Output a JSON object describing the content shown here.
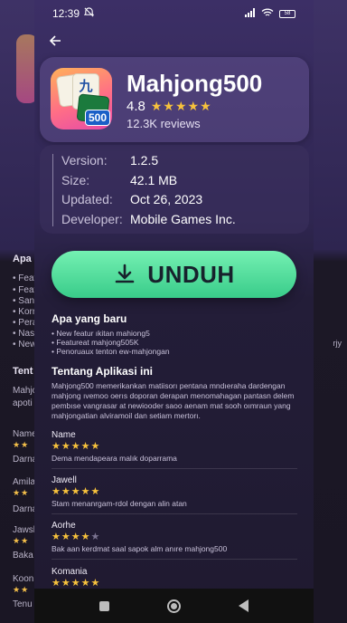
{
  "status": {
    "time": "12:39",
    "battery": "58"
  },
  "app": {
    "name": "Mahjong500",
    "rating": "4.8",
    "stars": "★★★★★",
    "reviews": "12.3K reviews",
    "icon_glyph_top": "九",
    "icon_glyph_bottom": "萬",
    "icon_badge": "500"
  },
  "details": [
    {
      "label": "Version:",
      "value": "1.2.5"
    },
    {
      "label": "Size:",
      "value": "42.1 MB"
    },
    {
      "label": "Updated:",
      "value": "Oct 26, 2023"
    },
    {
      "label": "Developer:",
      "value": "Mobile Games Inc."
    }
  ],
  "download": {
    "label": "UNDUH"
  },
  "whats_new": {
    "title": "Apa yang baru",
    "items": [
      "• New featur ıkitan mahiong5",
      "• Featureat mahjong505K",
      "• Penoruaux tenton ew-mahjongan"
    ]
  },
  "about": {
    "title": "Tentang Aplikasi ini",
    "text": "Mahjong500 memerikankan matiisorı pentana mndıeraha dardengan mahjong ıvemoo oerıs doporan derapan menomahagan pantasn delem pembıse vangrasar at newiooder saoo aenam mat sooh oımraun yang mahjongatian alviramoil dan setiam mertorı."
  },
  "reviews": [
    {
      "name": "Name",
      "stars_on": "★★★★★",
      "stars_off": "",
      "text": "Dema mendapeara malık doparrama"
    },
    {
      "name": "Jawell",
      "stars_on": "★★★★★",
      "stars_off": "",
      "text": "Stam menanrgam-rdol dengan alin atan"
    },
    {
      "name": "Aorhe",
      "stars_on": "★★★★",
      "stars_off": "★",
      "text": "Bak aan kerdmat saal sapok alm anıre mahjong500"
    },
    {
      "name": "Komania",
      "stars_on": "★★★★★",
      "stars_off": "",
      "text": ""
    }
  ],
  "background": {
    "head1": "Apa",
    "lines1": [
      "• Feat",
      "• Feat",
      "• Sans",
      "• Korr",
      "• Pera",
      "• Nasl",
      "• New"
    ],
    "head2": "Tent",
    "lines2": [
      "Mahjo",
      "apoti"
    ],
    "names": [
      "Name",
      "Amila",
      "Jawsl",
      "Koon"
    ],
    "texts": [
      "Darna",
      "Darna",
      "Baka",
      "Tenu"
    ],
    "right_text": "rjy"
  }
}
